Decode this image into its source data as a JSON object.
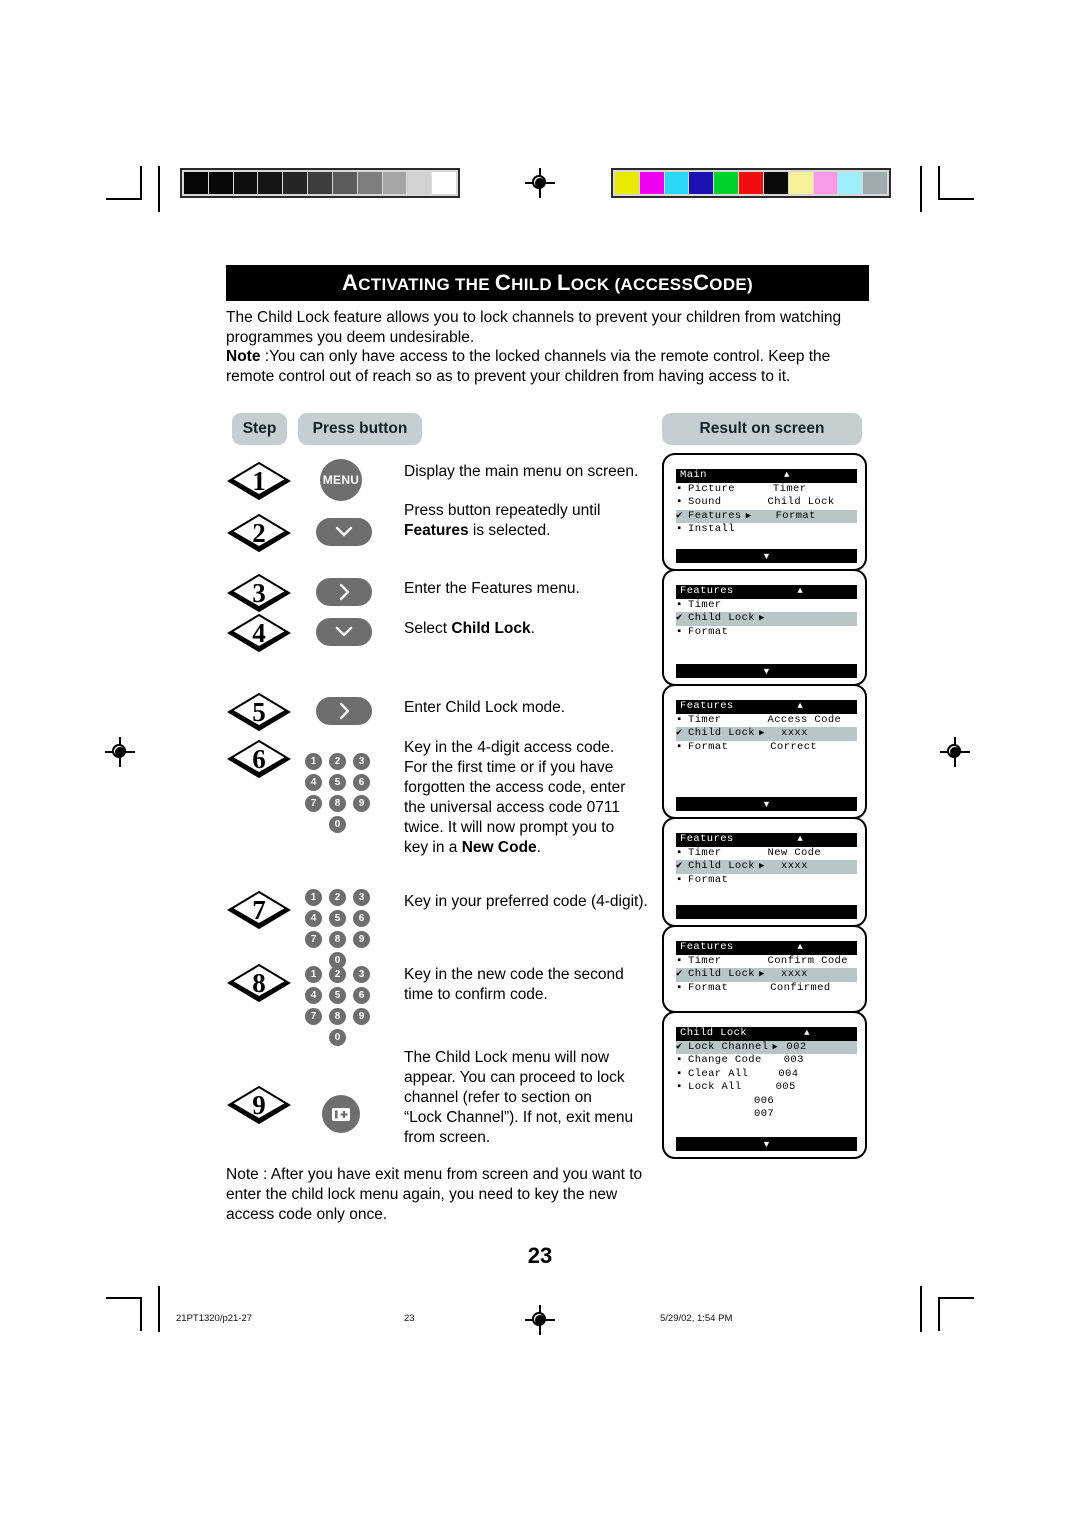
{
  "document": {
    "title_main": "ACTIVATING THE CHILD LOCK (ACCESSCODE)",
    "title_parts": [
      "A",
      "CTIVATING THE ",
      "C",
      "HILD ",
      "L",
      "OCK (A",
      "CCESS",
      "C",
      "ODE)"
    ],
    "page_number": "23",
    "intro_line1": "The Child Lock feature allows you to lock channels to prevent your children from watching",
    "intro_line2": "programmes you deem undesirable.",
    "note_label": "Note",
    "note_line1": " :You can only have access to the locked channels via the remote control. Keep the",
    "note_line2": "remote control out of reach so as to prevent your children from having access to it."
  },
  "table_headers": {
    "step": "Step",
    "press_button": "Press button",
    "result_on_screen": "Result on screen"
  },
  "steps": [
    {
      "number": "1",
      "button": "MENU",
      "button_type": "menu-round",
      "desc_html": "Display the main menu on screen."
    },
    {
      "number": "2",
      "button": "down",
      "button_type": "cursor-down",
      "desc_line1": "Press button repeatedly until",
      "desc_line2_bold": "Features",
      "desc_line2_rest": " is selected."
    },
    {
      "number": "3",
      "button": "right",
      "button_type": "cursor-right",
      "desc_html": "Enter the Features menu."
    },
    {
      "number": "4",
      "button": "down",
      "button_type": "cursor-down",
      "desc_pre": "Select ",
      "desc_bold": "Child Lock",
      "desc_post": "."
    },
    {
      "number": "5",
      "button": "right",
      "button_type": "cursor-right",
      "desc_html": "Enter Child Lock mode."
    },
    {
      "number": "6",
      "button": "keypad",
      "button_type": "numeric-keypad",
      "desc_lines": [
        "Key in the 4-digit access code.",
        "For the first time or if you have",
        "forgotten the access code, enter",
        "the universal access code 0711",
        "twice. It will now prompt you to"
      ],
      "desc_last_pre": "key in a ",
      "desc_last_bold": "New Code",
      "desc_last_post": "."
    },
    {
      "number": "7",
      "button": "keypad",
      "button_type": "numeric-keypad",
      "desc_html": "Key in your preferred code (4-digit)."
    },
    {
      "number": "8",
      "button": "keypad",
      "button_type": "numeric-keypad",
      "desc_line1": "Key in the new code the second",
      "desc_line2": "time to confirm code."
    },
    {
      "number": "9",
      "button": "status",
      "button_type": "status-button",
      "desc_lines": [
        "The Child Lock menu will now",
        "appear. You can proceed to lock",
        "channel (refer to section on",
        "“Lock Channel”). If not, exit menu",
        "from screen."
      ]
    }
  ],
  "keypad_keys": [
    "1",
    "2",
    "3",
    "4",
    "5",
    "6",
    "7",
    "8",
    "9",
    "0"
  ],
  "osd_screens": [
    {
      "title": "Main",
      "up_arrow": "▲",
      "down_arrow": "▼",
      "has_footbar": true,
      "rows": [
        {
          "marker": "▪",
          "name": "Picture",
          "arrow": "",
          "right": "Timer",
          "selected": false
        },
        {
          "marker": "▪",
          "name": "Sound",
          "arrow": "",
          "right": "Child Lock",
          "selected": false
        },
        {
          "marker": "✔",
          "name": "Features",
          "arrow": "▶",
          "right": "Format",
          "selected": true
        },
        {
          "marker": "▪",
          "name": "Install",
          "arrow": "",
          "right": "",
          "selected": false
        }
      ]
    },
    {
      "title": "Features",
      "up_arrow": "▲",
      "down_arrow": "▼",
      "has_footbar": true,
      "rows": [
        {
          "marker": "▪",
          "name": "Timer",
          "arrow": "",
          "right": "",
          "selected": false
        },
        {
          "marker": "✔",
          "name": "Child Lock",
          "arrow": "▶",
          "right": "",
          "selected": true
        },
        {
          "marker": "▪",
          "name": "Format",
          "arrow": "",
          "right": "",
          "selected": false
        }
      ]
    },
    {
      "title": "Features",
      "up_arrow": "▲",
      "down_arrow": "▼",
      "has_footbar": true,
      "rows": [
        {
          "marker": "▪",
          "name": "Timer",
          "arrow": "",
          "right": "Access Code",
          "selected": false
        },
        {
          "marker": "✔",
          "name": "Child Lock",
          "arrow": "▶",
          "right": "xxxx",
          "selected": true
        },
        {
          "marker": "▪",
          "name": "Format",
          "arrow": "",
          "right": "Correct",
          "selected": false
        }
      ]
    },
    {
      "title": "Features",
      "up_arrow": "▲",
      "down_arrow": "",
      "has_footbar": true,
      "rows": [
        {
          "marker": "▪",
          "name": "Timer",
          "arrow": "",
          "right": "New Code",
          "selected": false
        },
        {
          "marker": "✔",
          "name": "Child Lock",
          "arrow": "▶",
          "right": "xxxx",
          "selected": true
        },
        {
          "marker": "▪",
          "name": "Format",
          "arrow": "",
          "right": "",
          "selected": false
        }
      ]
    },
    {
      "title": "Features",
      "up_arrow": "▲",
      "down_arrow": "",
      "has_footbar": false,
      "rows": [
        {
          "marker": "▪",
          "name": "Timer",
          "arrow": "",
          "right": "Confirm Code",
          "selected": false
        },
        {
          "marker": "✔",
          "name": "Child Lock",
          "arrow": "▶",
          "right": "xxxx",
          "selected": true
        },
        {
          "marker": "▪",
          "name": "Format",
          "arrow": "",
          "right": "Confirmed",
          "selected": false
        }
      ]
    },
    {
      "title": "Child Lock",
      "up_arrow": "▲",
      "down_arrow": "▼",
      "has_footbar": true,
      "rows": [
        {
          "marker": "✔",
          "name": "Lock Channel",
          "arrow": "▶",
          "right": "002",
          "selected": true
        },
        {
          "marker": "▪",
          "name": "Change Code",
          "arrow": "",
          "right": "003",
          "selected": false
        },
        {
          "marker": "▪",
          "name": "Clear All",
          "arrow": "",
          "right": "004",
          "selected": false
        },
        {
          "marker": "▪",
          "name": "Lock All",
          "arrow": "",
          "right": "005",
          "selected": false
        },
        {
          "marker": "",
          "name": "",
          "arrow": "",
          "right": "006",
          "selected": false
        },
        {
          "marker": "",
          "name": "",
          "arrow": "",
          "right": "007",
          "selected": false
        }
      ]
    }
  ],
  "end_note": {
    "line1": "Note : After you have exit menu from screen and you want to",
    "line2": "enter the child lock menu again, you need to key the new",
    "line3": "access code only once."
  },
  "printer_footer": {
    "file": "21PT1320/p21-27",
    "page": "23",
    "timestamp": "5/29/02, 1:54 PM"
  },
  "calibration": {
    "grayscale": [
      "#050505",
      "#080808",
      "#0e0e0e",
      "#151515",
      "#252525",
      "#3d3d3d",
      "#5c5c5c",
      "#7d7d7d",
      "#a5a5a5",
      "#d2d2d2",
      "#ffffff"
    ],
    "colors": [
      "#eaea00",
      "#f000f0",
      "#2ad9f5",
      "#1a12b0",
      "#00d22a",
      "#ef0d0d",
      "#0a0a0a",
      "#f7f29a",
      "#f99ae8",
      "#9fefff",
      "#9eacad"
    ]
  },
  "theme": {
    "pill_bg": "#c5ced1",
    "button_gray": "#6e6e6e",
    "osd_selected": "#b9c6c8",
    "osd_header_bg": "#000000"
  }
}
